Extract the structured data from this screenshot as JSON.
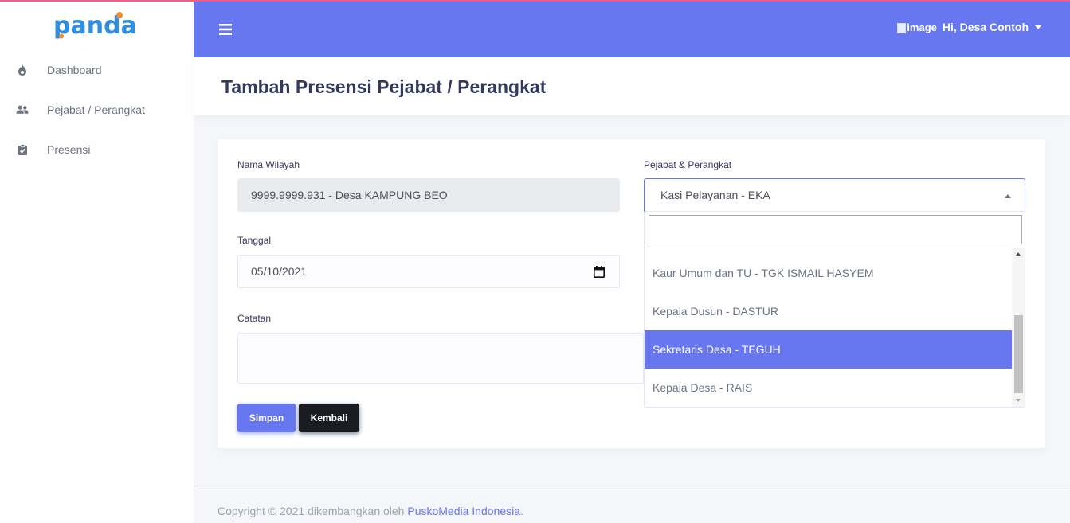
{
  "brand": {
    "logo_text": "panda"
  },
  "colors": {
    "primary": "#6777ef",
    "dark_button": "#191d21",
    "top_accent": "#e8608a",
    "logo_blue": "#2f8ee0",
    "logo_orange": "#f28c28"
  },
  "sidebar": {
    "items": [
      {
        "label": "Dashboard",
        "icon": "fire-icon"
      },
      {
        "label": "Pejabat / Perangkat",
        "icon": "users-icon"
      },
      {
        "label": "Presensi",
        "icon": "clipboard-check-icon"
      }
    ]
  },
  "topbar": {
    "user_image_alt": "image",
    "user_greeting": "Hi, Desa Contoh"
  },
  "page": {
    "title": "Tambah Presensi Pejabat / Perangkat"
  },
  "form": {
    "nama_wilayah": {
      "label": "Nama Wilayah",
      "value": "9999.9999.931 - Desa KAMPUNG BEO"
    },
    "tanggal": {
      "label": "Tanggal",
      "value": "05/10/2021"
    },
    "catatan": {
      "label": "Catatan",
      "value": ""
    },
    "pejabat": {
      "label": "Pejabat & Perangkat",
      "selected": "Kasi Pelayanan - EKA",
      "search_value": "",
      "visible_options": [
        "Kaur Umum dan TU - TGK ISMAIL HASYEM",
        "Kepala Dusun - DASTUR",
        "Sekretaris Desa - TEGUH",
        "Kepala Desa - RAIS"
      ],
      "highlighted_option": "Sekretaris Desa - TEGUH"
    },
    "buttons": {
      "save": "Simpan",
      "back": "Kembali"
    }
  },
  "footer": {
    "text": "Copyright © 2021 dikembangkan oleh",
    "link": "PuskoMedia Indonesia",
    "end": "."
  }
}
